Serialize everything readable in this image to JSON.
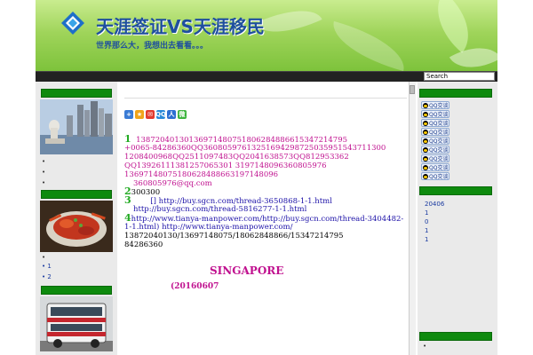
{
  "header": {
    "title": "天涯签证VS天涯移民",
    "tagline": "世界那么大，我想出去看看。。。"
  },
  "search": {
    "value": "Search"
  },
  "left_sidebar": {
    "block1_bullets": [
      "•",
      "•",
      "•"
    ],
    "block2_bullets": [
      "•"
    ],
    "block2_links": [
      "1",
      "2"
    ]
  },
  "main": {
    "share_icons": [
      "+",
      "★",
      "✉",
      "QQ",
      "人",
      "微"
    ],
    "item1_num": "1",
    "line1": "13872040130136971480751806284886615347214795",
    "line2": "+0065-84286360QQ360805976132516942987250359515437113​00",
    "line3": "1208400968QQ2511097483QQ2041638573QQ812953362",
    "line4": "QQ1392611138125706530​1  3197148096360805976",
    "line5": "13697148075180628488663197148096",
    "line6": "360805976@qq.com",
    "item2_num": "2",
    "line7": "300300",
    "item3_num": "3",
    "line8": "[]          http://buy.sgcn.com/thread-3650868-1-1.html",
    "line9": "http://buy.sgcn.com/thread-5816277-1-1.html",
    "item4_num": "4",
    "line10": "http://www.tianya-manpower.com/http://buy.sgcn.com/thread-3404482-",
    "line11": "1-1.html)                 http://www.tianya-manpower.com/",
    "line12": "13872040130/13697148075/18062848866/15347214795",
    "line13": "84286360",
    "singapore_title": "SINGAPORE",
    "singapore_date": "(20160607"
  },
  "right_sidebar": {
    "qq_label": "QQ交谈",
    "qq_count": 9,
    "links": [
      "20406",
      "1",
      "0",
      "1",
      "1"
    ],
    "bottom_bullet": "•"
  },
  "colors": {
    "header_green": "#9fd45a",
    "sidebar_bar": "#0e8a0e",
    "title_blue": "#1e4f9e",
    "pink_text": "#c0118f",
    "blue_text": "#1d12a8"
  }
}
